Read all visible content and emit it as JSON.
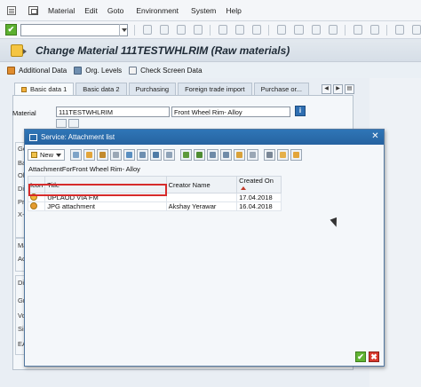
{
  "menu": {
    "items": [
      "Material",
      "Edit",
      "Goto",
      "Environment",
      "System",
      "Help"
    ]
  },
  "title": "Change Material 111TESTWHLRIM (Raw materials)",
  "app_toolbar": {
    "additional_data": "Additional Data",
    "org_levels": "Org. Levels",
    "check_screen_data": "Check Screen Data"
  },
  "tabs": [
    "Basic data 1",
    "Basic data 2",
    "Purchasing",
    "Foreign trade import",
    "Purchase or..."
  ],
  "tab_nav": [
    "◀",
    "▶",
    "▤"
  ],
  "material": {
    "label": "Material",
    "value": "111TESTWHLRIM",
    "description": "Front Wheel Rim- Alloy",
    "info": "i"
  },
  "background_group_labels": [
    "Ge",
    "Ba",
    "Ol",
    "Di",
    "Pr",
    "X-",
    "Ma",
    "Ac",
    "Di",
    "Gr",
    "Vo",
    "Si",
    "EA"
  ],
  "dialog": {
    "title": "Service: Attachment list",
    "new_label": "New",
    "subtitle": "AttachmentForFront Wheel Rim- Alloy",
    "columns": [
      "Icon",
      "Title",
      "Creator Name",
      "Created On"
    ],
    "rows": [
      {
        "title": "UPLAOD VIA FM",
        "creator": "",
        "created_on": "17.04.2018"
      },
      {
        "title": "JPG attachment",
        "creator": "Akshay Yerawar",
        "created_on": "16.04.2018"
      }
    ],
    "ok": "✔",
    "cancel": "✖",
    "close": "✕"
  },
  "colors": {
    "dialog_header": "#2f76b7",
    "highlight": "#d62b2b",
    "ok": "#61b433",
    "cancel": "#d83a2e"
  }
}
